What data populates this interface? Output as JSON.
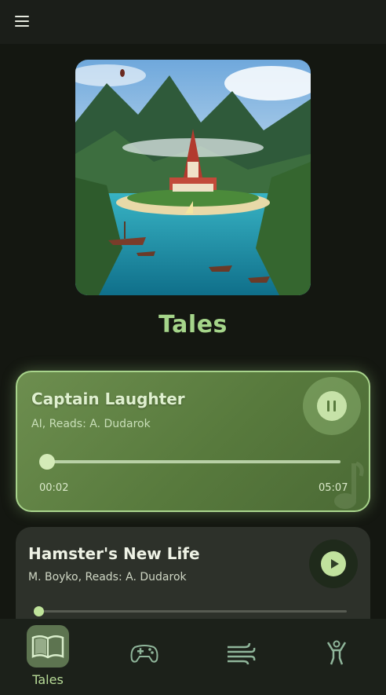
{
  "header": {
    "menu_icon": "hamburger-menu-icon"
  },
  "page": {
    "title": "Tales"
  },
  "now_playing": {
    "title": "Captain Laughter",
    "subtitle": "AI, Reads: A. Dudarok",
    "elapsed": "00:02",
    "duration": "05:07",
    "progress_fraction": 0.01,
    "state": "playing",
    "control_icon": "pause-icon"
  },
  "tracks": [
    {
      "title": "Hamster's New Life",
      "subtitle": "M. Boyko, Reads: A. Dudarok",
      "progress_fraction": 0,
      "control_icon": "play-icon"
    }
  ],
  "bottom_nav": {
    "items": [
      {
        "label": "Tales",
        "icon": "open-book-icon",
        "active": true
      },
      {
        "label": "",
        "icon": "gamepad-icon",
        "active": false
      },
      {
        "label": "",
        "icon": "wind-icon",
        "active": false
      },
      {
        "label": "",
        "icon": "exercise-person-icon",
        "active": false
      }
    ]
  },
  "colors": {
    "background": "#141711",
    "accent": "#a5d58a",
    "active_card": "#587a3d",
    "card": "#2d312a",
    "nav_bar": "#1c211a"
  }
}
